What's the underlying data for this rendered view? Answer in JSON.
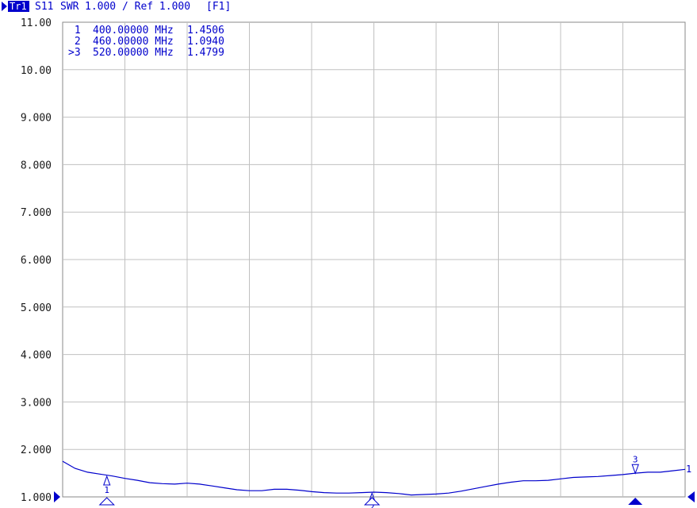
{
  "trace_header": {
    "trace_label": "Tr1",
    "parameter": "S11",
    "format": "SWR",
    "scale_text": "1.000 / Ref 1.000",
    "function_key": "[F1]"
  },
  "colors": {
    "trace": "#0000cc",
    "grid": "#c0c0c0",
    "text": "#0000cc",
    "axis_text": "#1a1a1a",
    "tag_bg": "#0000cc",
    "tag_fg": "#ffffff",
    "marker_fill": "#0000cc"
  },
  "markers": [
    {
      "id": "1",
      "prefix": " 1",
      "frequency": "400.00000 MHz",
      "value": "1.4506",
      "active": false
    },
    {
      "id": "2",
      "prefix": " 2",
      "frequency": "460.00000 MHz",
      "value": "1.0940",
      "active": false
    },
    {
      "id": "3",
      "prefix": ">3",
      "frequency": "520.00000 MHz",
      "value": "1.4799",
      "active": true
    }
  ],
  "reference_marker_label": "1",
  "chart_data": {
    "type": "line",
    "y_tick_labels": [
      "11.00",
      "10.00",
      "9.000",
      "8.000",
      "7.000",
      "6.000",
      "5.000",
      "4.000",
      "3.000",
      "2.000",
      "1.000"
    ],
    "ylim": [
      1.0,
      11.0
    ],
    "x_divisions": 10,
    "y_divisions": 10,
    "grid": true,
    "series": [
      {
        "x_fraction": [
          0.0,
          0.02,
          0.04,
          0.06,
          0.08,
          0.1,
          0.12,
          0.14,
          0.16,
          0.18,
          0.2,
          0.22,
          0.24,
          0.26,
          0.28,
          0.3,
          0.32,
          0.34,
          0.36,
          0.38,
          0.4,
          0.42,
          0.44,
          0.46,
          0.48,
          0.5,
          0.52,
          0.54,
          0.56,
          0.58,
          0.6,
          0.62,
          0.64,
          0.66,
          0.68,
          0.7,
          0.72,
          0.74,
          0.76,
          0.78,
          0.8,
          0.82,
          0.84,
          0.86,
          0.88,
          0.9,
          0.92,
          0.94,
          0.96,
          0.98,
          1.0
        ],
        "values": [
          1.75,
          1.6,
          1.52,
          1.48,
          1.44,
          1.39,
          1.35,
          1.3,
          1.28,
          1.27,
          1.29,
          1.27,
          1.23,
          1.19,
          1.15,
          1.13,
          1.13,
          1.16,
          1.16,
          1.14,
          1.11,
          1.09,
          1.08,
          1.08,
          1.09,
          1.1,
          1.09,
          1.07,
          1.04,
          1.05,
          1.06,
          1.08,
          1.12,
          1.17,
          1.22,
          1.27,
          1.31,
          1.34,
          1.34,
          1.35,
          1.38,
          1.41,
          1.42,
          1.43,
          1.45,
          1.47,
          1.5,
          1.52,
          1.52,
          1.55,
          1.58
        ]
      }
    ],
    "marker_positions": [
      {
        "id": "1",
        "x_fraction": 0.071,
        "value": 1.4506
      },
      {
        "id": "2",
        "x_fraction": 0.497,
        "value": 1.094
      },
      {
        "id": "3",
        "x_fraction": 0.92,
        "value": 1.4799
      }
    ]
  }
}
